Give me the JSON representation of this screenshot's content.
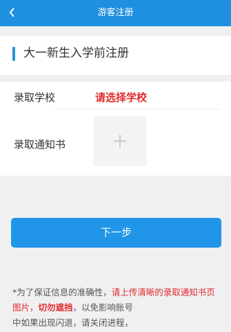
{
  "header": {
    "title": "游客注册",
    "back_icon": "chevron-left-icon"
  },
  "section": {
    "title": "大一新生入学前注册",
    "accent_color": "#2b90d9"
  },
  "form": {
    "school_label": "录取学校",
    "school_placeholder": "请选择学校",
    "letter_label": "录取通知书",
    "upload_icon": "plus-icon"
  },
  "actions": {
    "next_label": "下一步"
  },
  "notice": {
    "part1": "*为了保证信息的准确性，",
    "part2": "请上传清晰的录取通知书页图片，",
    "part3": "切勿遮挡",
    "part4": "，以免影响账号",
    "part5": "中如果出现闪退，请关闭进程，"
  },
  "colors": {
    "navbar": "#1f8fe0",
    "button": "#2196e8",
    "warning": "#e12b2b"
  }
}
